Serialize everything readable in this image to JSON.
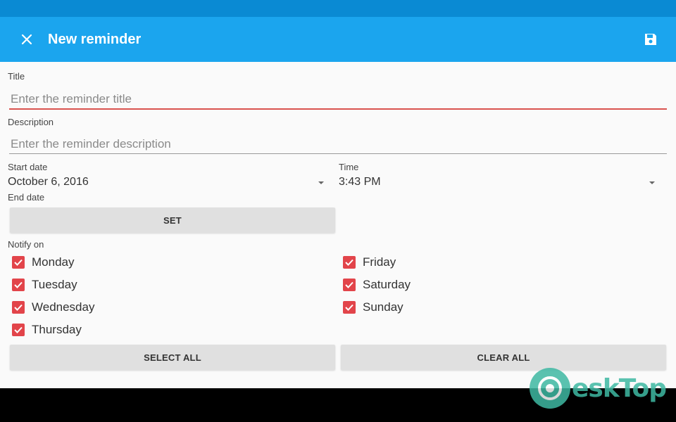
{
  "app_bar": {
    "title": "New reminder",
    "close_icon": "close-icon",
    "save_icon": "save-icon",
    "color": "#1ba5ee"
  },
  "form": {
    "title_label": "Title",
    "title_placeholder": "Enter the reminder title",
    "description_label": "Description",
    "description_placeholder": "Enter the reminder description",
    "start_date_label": "Start date",
    "start_date_value": "October 6, 2016",
    "time_label": "Time",
    "time_value": "3:43 PM",
    "end_date_label": "End date",
    "set_button": "SET",
    "notify_label": "Notify on"
  },
  "days": [
    {
      "label": "Monday",
      "checked": true
    },
    {
      "label": "Tuesday",
      "checked": true
    },
    {
      "label": "Wednesday",
      "checked": true
    },
    {
      "label": "Thursday",
      "checked": true
    },
    {
      "label": "Friday",
      "checked": true
    },
    {
      "label": "Saturday",
      "checked": true
    },
    {
      "label": "Sunday",
      "checked": true
    }
  ],
  "buttons": {
    "select_all": "SELECT ALL",
    "clear_all": "CLEAR ALL"
  },
  "watermark": {
    "text": "eskTop"
  },
  "colors": {
    "accent": "#e2444a",
    "primary": "#1ba5ee",
    "status_bar": "#0a8ad3"
  }
}
